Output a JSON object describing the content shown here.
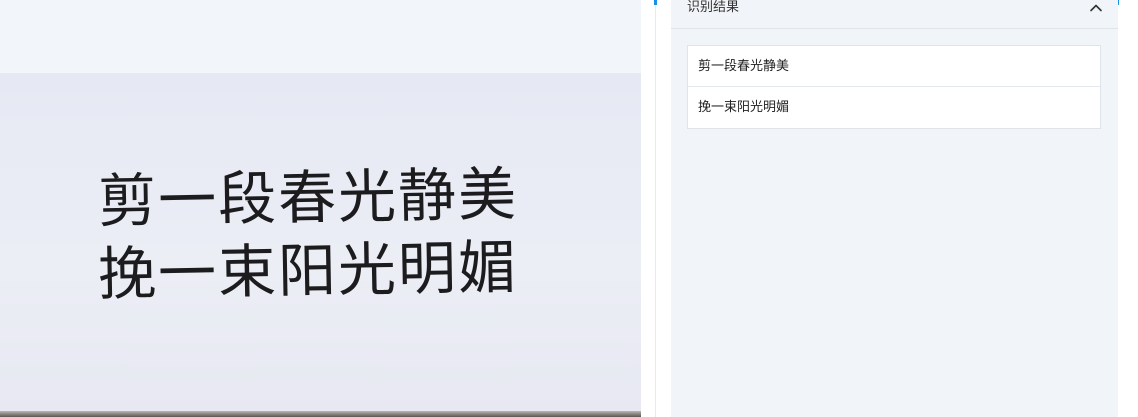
{
  "results_panel": {
    "title": "识别结果",
    "collapse_icon": "chevron-up-icon",
    "lines": [
      "剪一段春光静美",
      "挽一束阳光明媚"
    ]
  },
  "image_preview": {
    "handwritten_lines": [
      "剪一段春光静美",
      "挽一束阳光明媚"
    ]
  },
  "colors": {
    "accent": "#1a8fe3",
    "panel_bg": "#f1f4f8",
    "border": "#dfe3ea"
  }
}
